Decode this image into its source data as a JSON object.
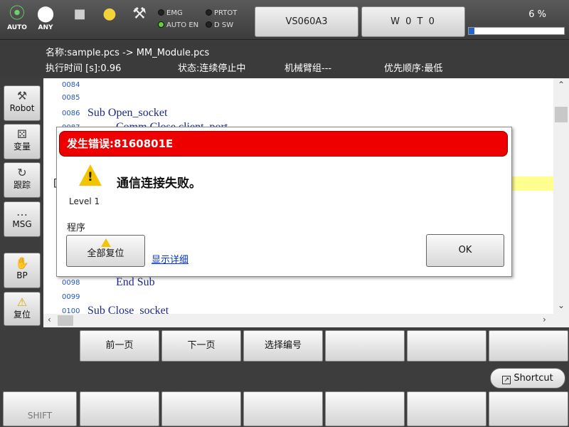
{
  "topbar": {
    "mode_label": "AUTO",
    "any_label": "ANY",
    "leds": [
      {
        "label": "EMG",
        "on": false
      },
      {
        "label": "PRTOT",
        "on": false
      },
      {
        "label": "AUTO EN",
        "on": true
      },
      {
        "label": "D SW",
        "on": false
      }
    ],
    "robot_button": "VS060A3",
    "tool_button": "W 0 T 0",
    "speed_text": "6 %",
    "speed_value": 6
  },
  "info": {
    "name_line": "名称:sample.pcs -> MM_Module.pcs",
    "exec_time": "执行时间 [s]:0.96",
    "status": "状态:连续停止中",
    "arm_group": "机械臂组---",
    "priority": "优先顺序:最低"
  },
  "sidebar": {
    "items": [
      {
        "label": "Robot",
        "icon": "robot-arm-icon"
      },
      {
        "label": "变量",
        "icon": "dice-icon"
      },
      {
        "label": "跟踪",
        "icon": "trace-icon"
      },
      {
        "label": "MSG",
        "icon": "chat-bubble-icon"
      },
      {
        "label": "BP",
        "icon": "hand-icon"
      },
      {
        "label": "复位",
        "icon": "warning-icon"
      }
    ]
  },
  "editor": {
    "lines": [
      {
        "num": "0084",
        "text": ""
      },
      {
        "num": "0085",
        "text": ""
      },
      {
        "num": "0086",
        "text": "Sub Open_socket"
      },
      {
        "num": "0087",
        "text": "Comm.Close client_port"
      },
      {
        "num": "0098",
        "text": "End Sub"
      },
      {
        "num": "0099",
        "text": ""
      },
      {
        "num": "0100",
        "text": "Sub Close_socket"
      }
    ],
    "partial_char": "["
  },
  "dialog": {
    "title": "发生错误:8160801E",
    "message": "通信连接失败。",
    "level": "Level 1",
    "source": "程序",
    "reset_all": "全部复位",
    "show_details": "显示详细",
    "ok": "OK"
  },
  "fkeys": {
    "row1": [
      "",
      "前一页",
      "下一页",
      "选择编号",
      "",
      "",
      ""
    ],
    "shortcut": "Shortcut",
    "row2": [
      "SHIFT",
      "",
      "",
      "",
      "",
      "",
      ""
    ]
  }
}
